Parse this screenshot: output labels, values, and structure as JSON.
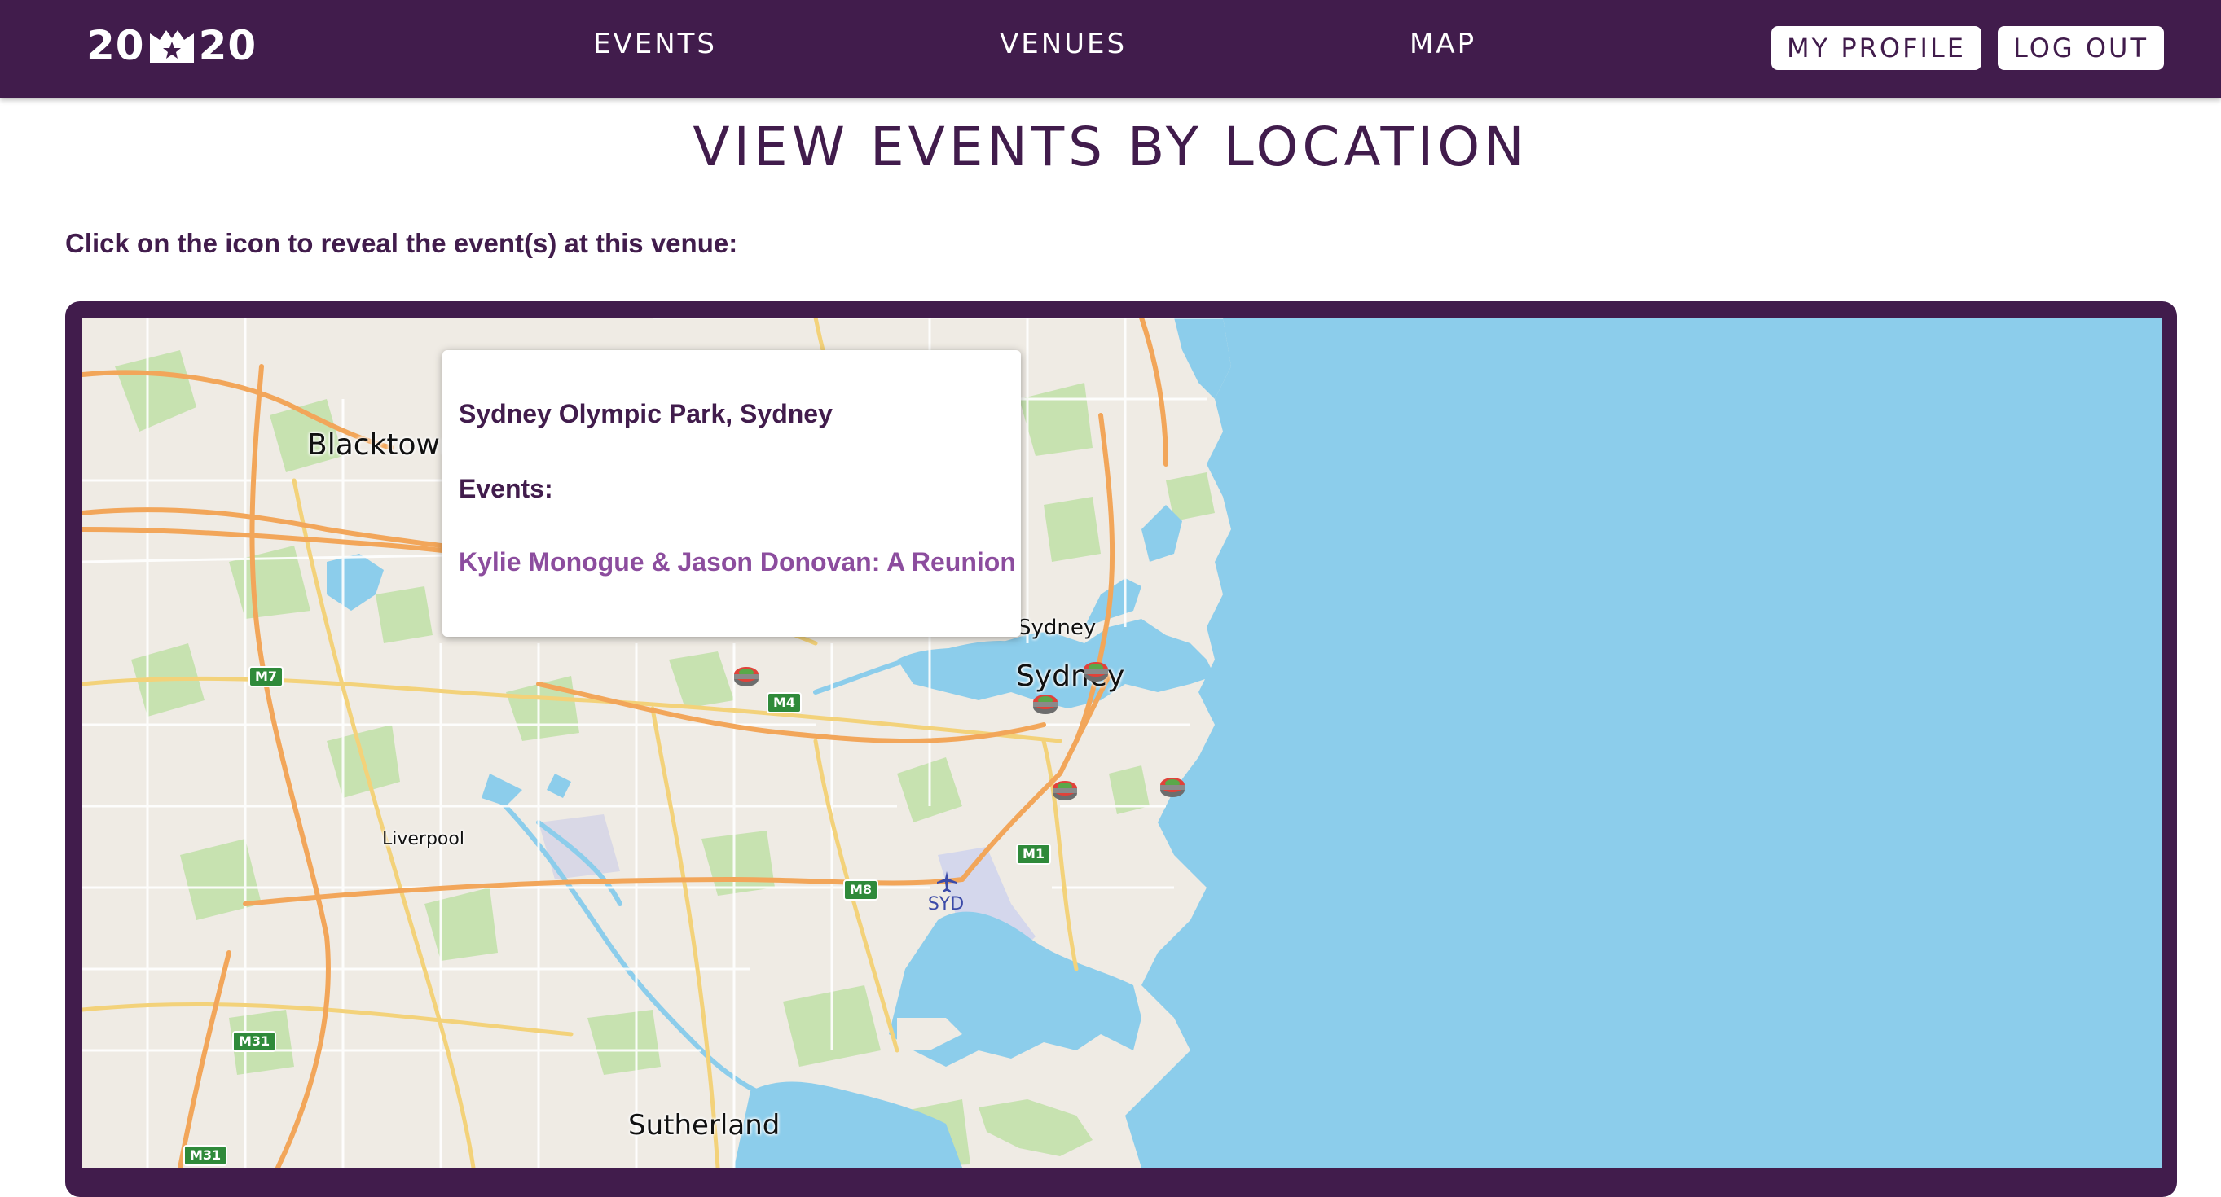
{
  "nav": {
    "logo_left": "20",
    "logo_right": "20",
    "links": [
      "EVENTS",
      "VENUES",
      "MAP"
    ],
    "profile_label": "MY PROFILE",
    "logout_label": "LOG OUT"
  },
  "page": {
    "title": "VIEW EVENTS BY LOCATION",
    "instructions": "Click on the icon to reveal the event(s) at this venue:"
  },
  "map": {
    "places": {
      "blacktown": "Blacktown",
      "sydney": "Sydney",
      "north_sydney": "Sydney",
      "liverpool": "Liverpool",
      "sutherland": "Sutherland"
    },
    "roads": {
      "m7": "M7",
      "m4": "M4",
      "m1": "M1",
      "m8": "M8",
      "m31_a": "M31",
      "m31_b": "M31"
    },
    "airport_code": "SYD",
    "popup": {
      "venue": "Sydney Olympic Park, Sydney",
      "events_heading": "Events:",
      "event_link": "Kylie Monogue & Jason Donovan: A Reunion"
    }
  },
  "colors": {
    "brand": "#411c4c",
    "link": "#8c4d9e",
    "water": "#8ccdeb",
    "land": "#efebe4",
    "park": "#c7e2b0",
    "highway": "#f2a65a",
    "major_road": "#f3d27a"
  }
}
